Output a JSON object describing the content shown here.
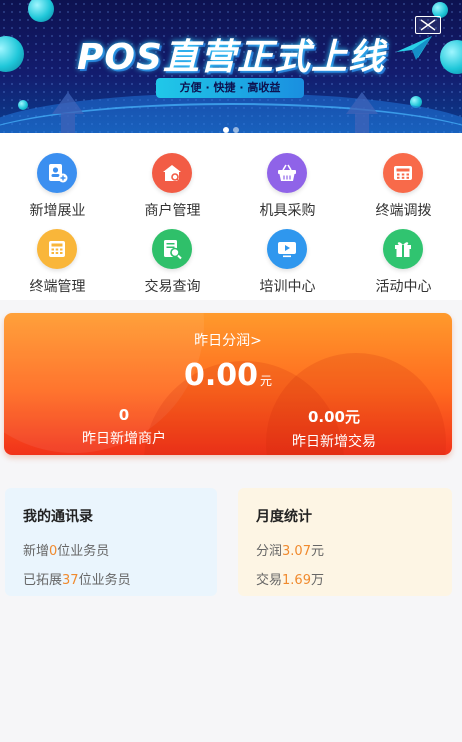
{
  "banner": {
    "title": "POS直营正式上线",
    "tagline": "方便 · 快捷 · 高收益",
    "close_icon": "mail-close-icon",
    "pager_count": 2,
    "pager_active": 0
  },
  "grid": {
    "items": [
      {
        "label": "新增展业",
        "icon": "add-user-icon",
        "color": "#3b8ff0"
      },
      {
        "label": "商户管理",
        "icon": "shop-icon",
        "color": "#f25c45"
      },
      {
        "label": "机具采购",
        "icon": "cart-icon",
        "color": "#8f63e8"
      },
      {
        "label": "终端调拨",
        "icon": "pos-terminal-icon",
        "color": "#f86a4a"
      },
      {
        "label": "终端管理",
        "icon": "calculator-icon",
        "color": "#f9b63a"
      },
      {
        "label": "交易查询",
        "icon": "search-document-icon",
        "color": "#2fc06a"
      },
      {
        "label": "培训中心",
        "icon": "video-icon",
        "color": "#2f97ee"
      },
      {
        "label": "活动中心",
        "icon": "gift-icon",
        "color": "#30c470"
      }
    ]
  },
  "profit_card": {
    "link_label": "昨日分润>",
    "value": "0.00",
    "unit": "元",
    "left_value": "0",
    "left_label": "昨日新增商户",
    "right_value": "0.00元",
    "right_label": "昨日新增交易"
  },
  "contacts_panel": {
    "title": "我的通讯录",
    "line1_prefix": "新增",
    "line1_num": "0",
    "line1_suffix": "位业务员",
    "line2_prefix": "已拓展",
    "line2_num": "37",
    "line2_suffix": "位业务员"
  },
  "monthly_panel": {
    "title": "月度统计",
    "line1_prefix": "分润",
    "line1_num": "3.07",
    "line1_suffix": "元",
    "line2_prefix": "交易",
    "line2_num": "1.69",
    "line2_suffix": "万"
  },
  "colors": {
    "accent_orange": "#f08a2e",
    "banner_bg": "#131c6e"
  }
}
